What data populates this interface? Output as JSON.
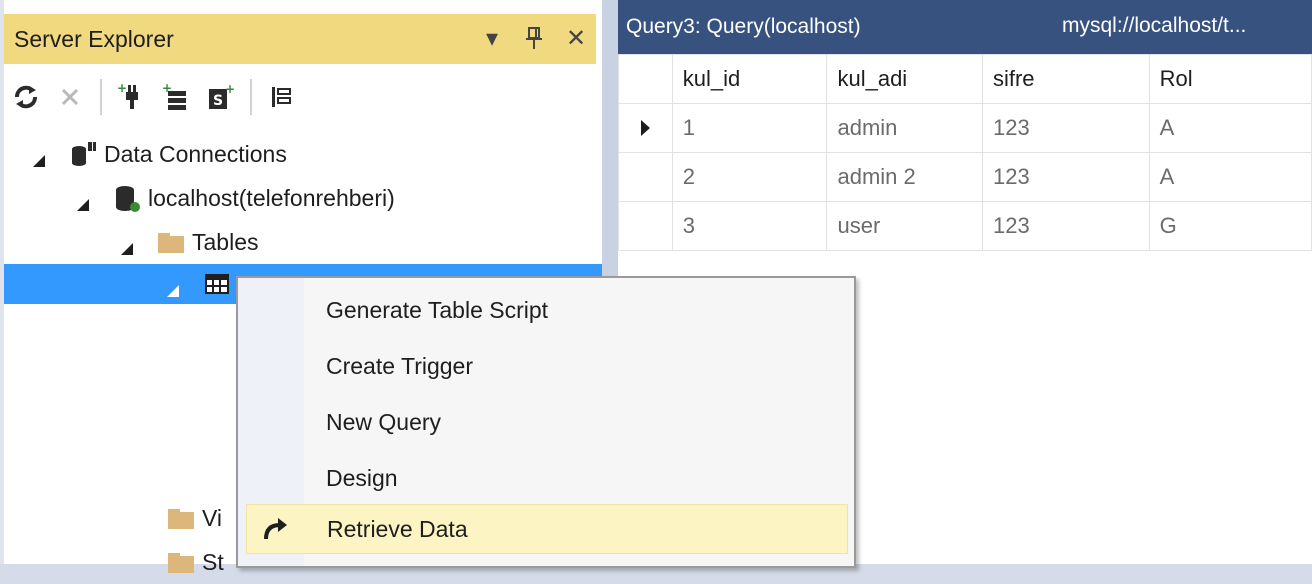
{
  "server_explorer": {
    "title": "Server Explorer",
    "title_controls": [
      {
        "icon": "dropdown-arrow-icon",
        "glyph": "▾"
      },
      {
        "icon": "pin-icon",
        "glyph": "ᵽ"
      },
      {
        "icon": "close-icon",
        "glyph": "✕"
      }
    ],
    "toolbar": [
      {
        "icon": "refresh-icon"
      },
      {
        "icon": "stop-icon"
      },
      {
        "icon": "connect-to-database-icon"
      },
      {
        "icon": "connect-to-server-icon"
      },
      {
        "icon": "connect-to-sharepoint-icon"
      },
      {
        "icon": "properties-icon"
      }
    ],
    "tree": [
      {
        "label": "Data Connections",
        "icon": "data-connections-icon"
      },
      {
        "label": "localhost(telefonrehberi)",
        "icon": "database-icon"
      },
      {
        "label": "Tables",
        "icon": "folder-icon"
      },
      {
        "label": "",
        "icon": "table-icon",
        "selected": true
      },
      {
        "label": "Vi",
        "icon": "folder-icon"
      },
      {
        "label": "St",
        "icon": "folder-icon"
      }
    ]
  },
  "query": {
    "tab_title": "Query3: Query(localhost)",
    "tab_url": "mysql://localhost/t...",
    "columns": [
      "kul_id",
      "kul_adi",
      "sifre",
      "Rol"
    ],
    "rows": [
      [
        "1",
        "admin",
        "123",
        "A"
      ],
      [
        "2",
        "admin 2",
        "123",
        "A"
      ],
      [
        "3",
        "user",
        "123",
        "G"
      ]
    ],
    "current_row_index": 0
  },
  "context_menu": {
    "items": [
      {
        "label": "Generate Table Script"
      },
      {
        "label": "Create Trigger"
      },
      {
        "label": "New Query"
      },
      {
        "label": "Design"
      },
      {
        "label": "Retrieve Data",
        "icon": "retrieve-data-icon",
        "highlighted": true
      }
    ]
  },
  "colors": {
    "title_bar_active": "#f0d97f",
    "selection": "#3399ff",
    "tab_background": "#37527f",
    "menu_highlight": "#fdf4c4"
  }
}
